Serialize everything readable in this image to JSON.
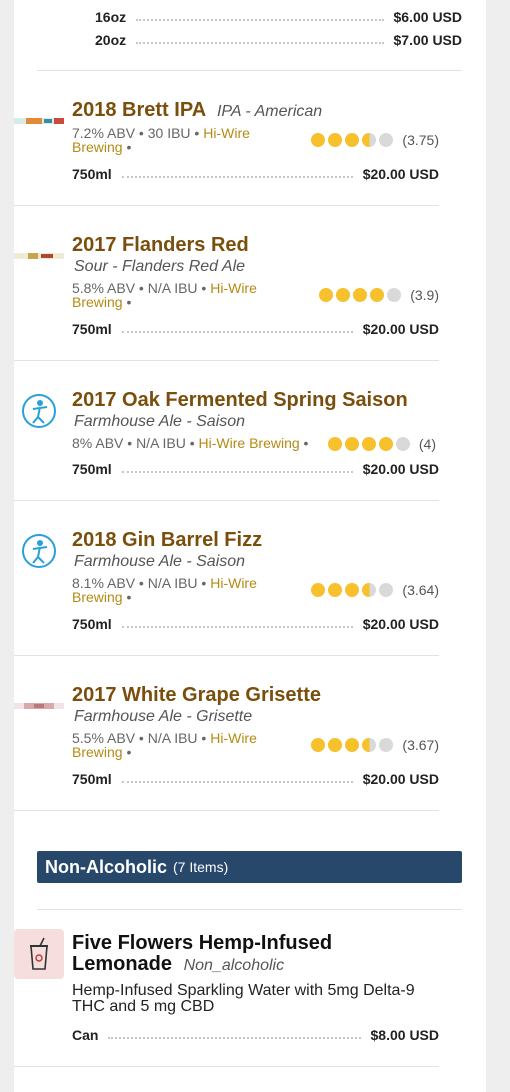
{
  "top_prices": [
    {
      "size": "16oz",
      "price": "$6.00 USD"
    },
    {
      "size": "20oz",
      "price": "$7.00 USD"
    }
  ],
  "beers": [
    {
      "name": "2018 Brett IPA",
      "style": "IPA - American",
      "abv": "7.2% ABV",
      "ibu": "30 IBU",
      "brewery": "Hi-Wire Brewing",
      "rating": 3.75,
      "rating_text": "(3.75)",
      "size": "750ml",
      "price": "$20.00 USD",
      "thumb": "bottle-label"
    },
    {
      "name": "2017 Flanders Red",
      "style": "Sour - Flanders Red Ale",
      "abv": "5.8% ABV",
      "ibu": "N/A IBU",
      "brewery": "Hi-Wire Brewing",
      "rating": 3.9,
      "rating_text": "(3.9)",
      "size": "750ml",
      "price": "$20.00 USD",
      "thumb": "bottle-label"
    },
    {
      "name": "2017 Oak Fermented Spring Saison",
      "style": "Farmhouse Ale - Saison",
      "abv": "8% ABV",
      "ibu": "N/A IBU",
      "brewery": "Hi-Wire Brewing",
      "rating": 4,
      "rating_text": "(4)",
      "size": "750ml",
      "price": "$20.00 USD",
      "thumb": "brewery-logo"
    },
    {
      "name": "2018 Gin Barrel Fizz",
      "style": "Farmhouse Ale - Saison",
      "abv": "8.1% ABV",
      "ibu": "N/A IBU",
      "brewery": "Hi-Wire Brewing",
      "rating": 3.64,
      "rating_text": "(3.64)",
      "size": "750ml",
      "price": "$20.00 USD",
      "thumb": "brewery-logo"
    },
    {
      "name": "2017 White Grape Grisette",
      "style": "Farmhouse Ale - Grisette",
      "abv": "5.5% ABV",
      "ibu": "N/A IBU",
      "brewery": "Hi-Wire Brewing",
      "rating": 3.67,
      "rating_text": "(3.67)",
      "size": "750ml",
      "price": "$20.00 USD",
      "thumb": "bottle-label"
    }
  ],
  "non_alcoholic": {
    "heading": "Non-Alcoholic",
    "count": "(7 Items)",
    "item": {
      "name_line1": "Five Flowers Hemp-Infused",
      "name_line2": "Lemonade",
      "style": "Non_alcoholic",
      "description": "Hemp-Infused Sparkling Water with 5mg Delta-9 THC and 5 mg CBD",
      "size": "Can",
      "price": "$8.00 USD",
      "icon": "drink-cup-icon"
    }
  },
  "colors": {
    "accent": "#7a4e0c",
    "brewery": "#b58a14",
    "section": "#27486b",
    "rating_on": "#f6c12c",
    "rating_off": "#d9d9d9"
  }
}
